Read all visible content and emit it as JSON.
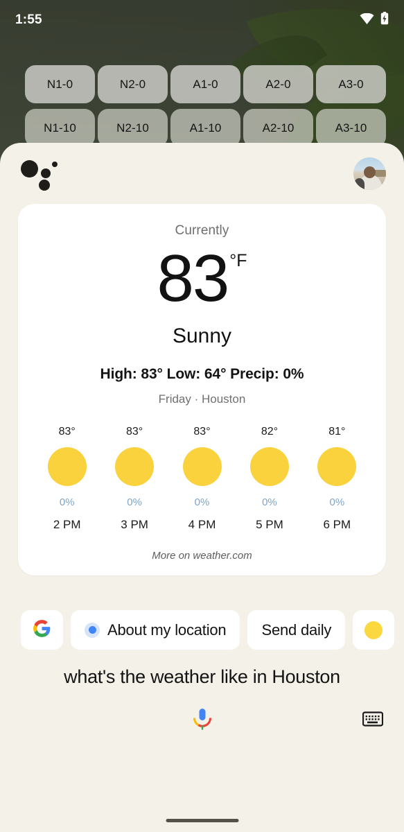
{
  "status_bar": {
    "time": "1:55",
    "wifi_icon": "wifi-icon",
    "battery_icon": "battery-charging-icon"
  },
  "home_screen": {
    "widget_rows": [
      {
        "buttons": [
          "N1-0",
          "N2-0",
          "A1-0",
          "A2-0",
          "A3-0"
        ]
      },
      {
        "buttons": [
          "N1-10",
          "N2-10",
          "A1-10",
          "A2-10",
          "A3-10"
        ]
      }
    ]
  },
  "assistant": {
    "logo_icon": "google-assistant-dots-icon",
    "avatar_icon": "user-avatar",
    "query_text": "what's the weather like in Houston",
    "mic_icon": "google-mic-icon",
    "keyboard_icon": "keyboard-icon",
    "chips": [
      {
        "label": "",
        "icon": "google-g-icon"
      },
      {
        "label": "About my location",
        "icon": "blue-location-dot-icon"
      },
      {
        "label": "Send daily",
        "icon": ""
      },
      {
        "label": "",
        "icon": "sun-icon"
      }
    ]
  },
  "weather_card": {
    "currently_label": "Currently",
    "temperature": "83",
    "unit": "°F",
    "condition": "Sunny",
    "high_low_precip": "High: 83° Low: 64°  Precip: 0%",
    "day_location": "Friday · Houston",
    "more_link": "More on weather.com",
    "hourly": [
      {
        "temp": "83°",
        "icon": "sun-icon",
        "precip": "0%",
        "time": "2 PM"
      },
      {
        "temp": "83°",
        "icon": "sun-icon",
        "precip": "0%",
        "time": "3 PM"
      },
      {
        "temp": "83°",
        "icon": "sun-icon",
        "precip": "0%",
        "time": "4 PM"
      },
      {
        "temp": "82°",
        "icon": "sun-icon",
        "precip": "0%",
        "time": "5 PM"
      },
      {
        "temp": "81°",
        "icon": "sun-icon",
        "precip": "0%",
        "time": "6 PM"
      }
    ]
  },
  "colors": {
    "sheet_background": "#f4f1e8",
    "card_background": "#ffffff",
    "sun_yellow": "#f9d23e",
    "precip_blue": "#80a5c3",
    "google_blue": "#4285f4",
    "google_red": "#ea4335",
    "google_yellow": "#fbbc05",
    "google_green": "#34a853"
  }
}
